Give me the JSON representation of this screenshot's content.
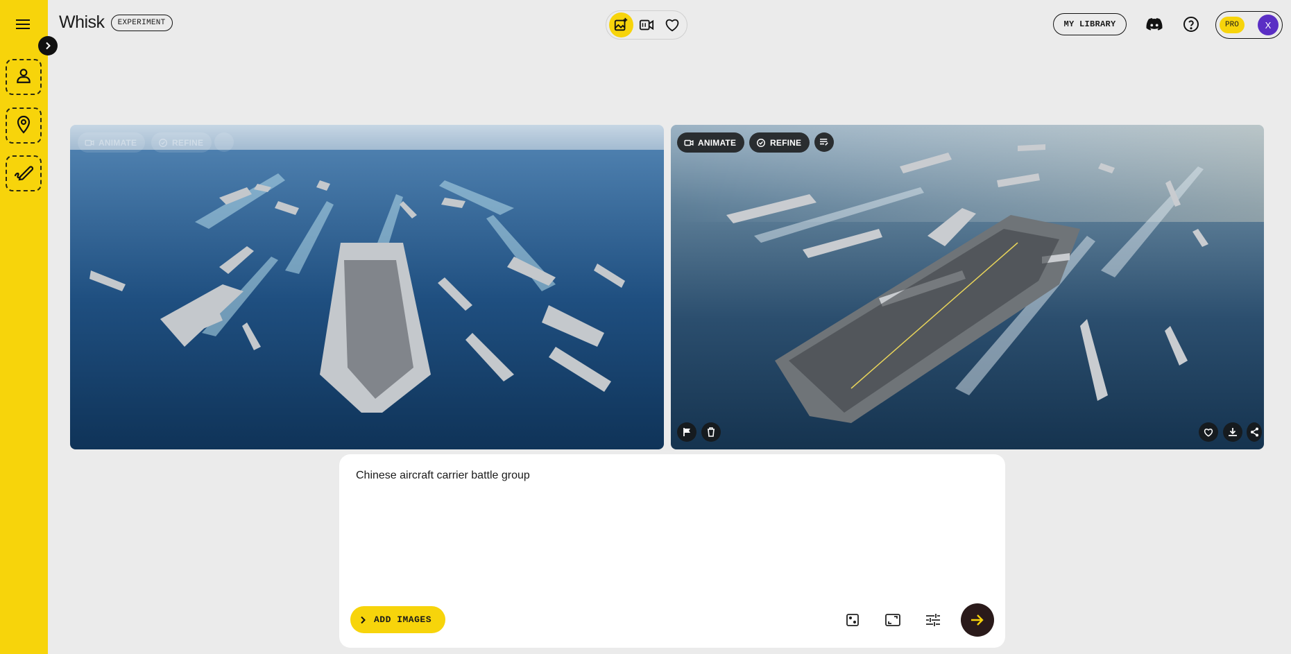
{
  "app": {
    "name": "Whisk",
    "badge": "EXPERIMENT"
  },
  "rail": {
    "slots": [
      {
        "icon": "person-icon",
        "label": "Subject"
      },
      {
        "icon": "location-pin-icon",
        "label": "Scene"
      },
      {
        "icon": "brush-icon",
        "label": "Style"
      }
    ]
  },
  "modes": [
    {
      "icon": "image-sparkle-icon",
      "active": true
    },
    {
      "icon": "video-animate-icon",
      "active": false
    },
    {
      "icon": "heart-icon",
      "active": false
    }
  ],
  "header": {
    "library_label": "MY LIBRARY",
    "pro_label": "PRO",
    "avatar_initial": "X"
  },
  "cards": [
    {
      "id": "left",
      "animate_label": "ANIMATE",
      "refine_label": "REFINE",
      "state": "dimmed-actions"
    },
    {
      "id": "right",
      "animate_label": "ANIMATE",
      "refine_label": "REFINE",
      "state": "hover"
    }
  ],
  "prompt": {
    "text": "Chinese aircraft carrier battle group",
    "add_images_label": "ADD IMAGES"
  },
  "colors": {
    "accent": "#f7d40b",
    "dark": "#111111",
    "avatar": "#5a2ec4"
  }
}
